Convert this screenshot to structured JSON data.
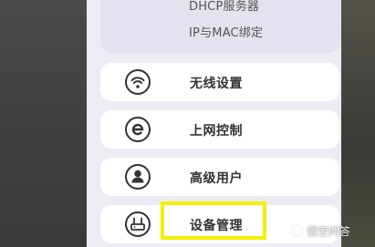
{
  "submenu": {
    "items": [
      {
        "label": "DHCP服务器"
      },
      {
        "label": "IP与MAC绑定"
      }
    ]
  },
  "menu": {
    "items": [
      {
        "label": "无线设置",
        "icon": "wifi-icon"
      },
      {
        "label": "上网控制",
        "icon": "e-icon"
      },
      {
        "label": "高级用户",
        "icon": "user-icon"
      },
      {
        "label": "设备管理",
        "icon": "router-icon"
      }
    ]
  },
  "highlight_color": "#f1f000",
  "watermark": {
    "text": "悟空问答",
    "icon": "wukong-logo-icon"
  }
}
